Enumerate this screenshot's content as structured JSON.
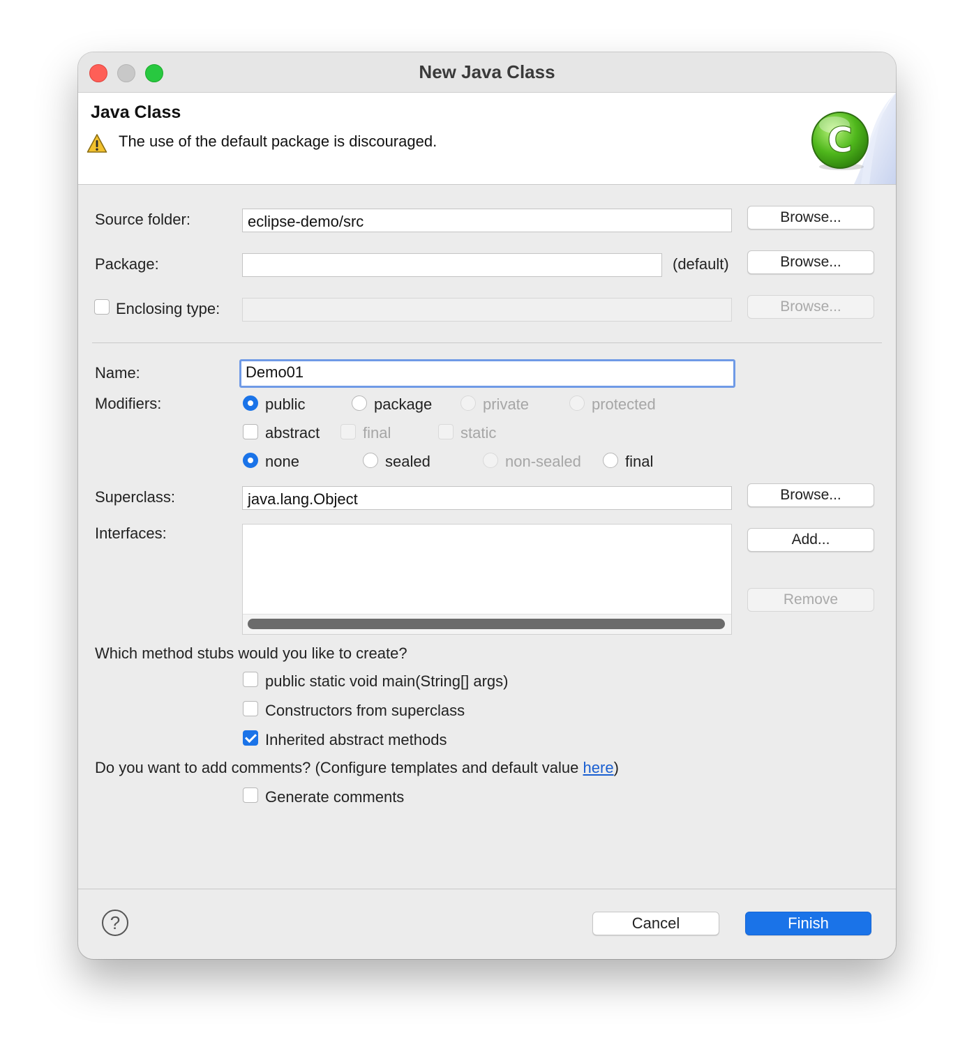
{
  "window": {
    "title": "New Java Class",
    "traffic_lights": {
      "close_color": "#fe5f57",
      "minimize_color": "#c8c8c8",
      "maximize_color": "#28c840"
    }
  },
  "banner": {
    "title": "Java Class",
    "message": "The use of the default package is discouraged.",
    "message_icon": "warning-icon",
    "wizard_icon": "java-class-wizard-icon",
    "wizard_icon_letter": "C"
  },
  "source_folder": {
    "label": "Source folder:",
    "value": "eclipse-demo/src",
    "browse": "Browse..."
  },
  "package": {
    "label": "Package:",
    "value": "",
    "hint": "(default)",
    "browse": "Browse..."
  },
  "enclosing_type": {
    "label": "Enclosing type:",
    "checked": false,
    "value": "",
    "browse": "Browse..."
  },
  "name": {
    "label": "Name:",
    "value": "Demo01"
  },
  "modifiers": {
    "label": "Modifiers:",
    "access": [
      {
        "label": "public",
        "checked": true,
        "enabled": true
      },
      {
        "label": "package",
        "checked": false,
        "enabled": true
      },
      {
        "label": "private",
        "checked": false,
        "enabled": false
      },
      {
        "label": "protected",
        "checked": false,
        "enabled": false
      }
    ],
    "flags": [
      {
        "label": "abstract",
        "checked": false,
        "enabled": true
      },
      {
        "label": "final",
        "checked": false,
        "enabled": false
      },
      {
        "label": "static",
        "checked": false,
        "enabled": false
      }
    ],
    "sealing": [
      {
        "label": "none",
        "checked": true,
        "enabled": true
      },
      {
        "label": "sealed",
        "checked": false,
        "enabled": true
      },
      {
        "label": "non-sealed",
        "checked": false,
        "enabled": false
      },
      {
        "label": "final",
        "checked": false,
        "enabled": true
      }
    ]
  },
  "superclass": {
    "label": "Superclass:",
    "value": "java.lang.Object",
    "browse": "Browse..."
  },
  "interfaces": {
    "label": "Interfaces:",
    "items": [],
    "add": "Add...",
    "remove": "Remove"
  },
  "method_stubs": {
    "question": "Which method stubs would you like to create?",
    "options": [
      {
        "label": "public static void main(String[] args)",
        "checked": false
      },
      {
        "label": "Constructors from superclass",
        "checked": false
      },
      {
        "label": "Inherited abstract methods",
        "checked": true
      }
    ]
  },
  "comments": {
    "question_prefix": "Do you want to add comments? (Configure templates and default value ",
    "link": "here",
    "question_suffix": ")",
    "option": {
      "label": "Generate comments",
      "checked": false
    }
  },
  "footer": {
    "help_icon": "help-icon",
    "help_glyph": "?",
    "cancel": "Cancel",
    "finish": "Finish"
  },
  "colors": {
    "accent": "#1a73e8",
    "window_bg": "#ececec",
    "link": "#1a5fd1"
  }
}
